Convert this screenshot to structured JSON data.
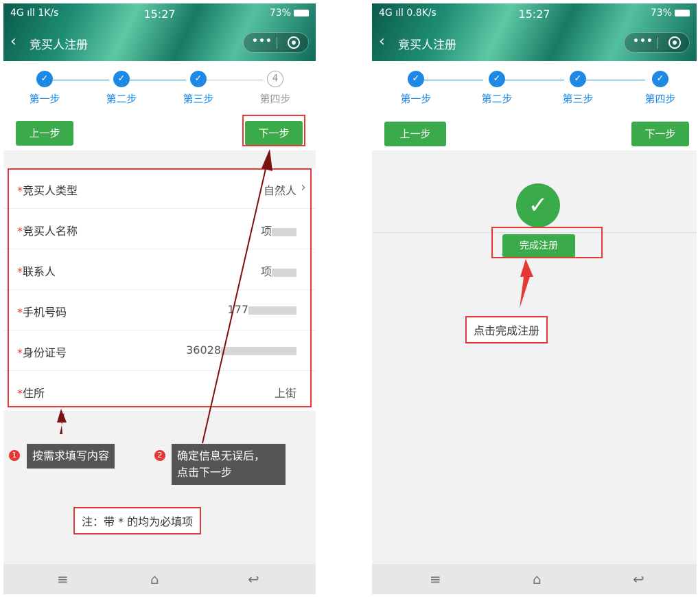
{
  "status_left": {
    "signal": "4G",
    "speed": "1K/s"
  },
  "status_right": {
    "signal": "4G",
    "speed": "0.8K/s"
  },
  "time": "15:27",
  "battery": "73%",
  "app_title": "竞买人注册",
  "steps": [
    "第一步",
    "第二步",
    "第三步",
    "第四步"
  ],
  "step4_number": "4",
  "prev_label": "上一步",
  "next_label": "下一步",
  "form": {
    "fields": [
      {
        "label": "竞买人类型",
        "value": "自然人"
      },
      {
        "label": "竞买人名称",
        "value": "项"
      },
      {
        "label": "联系人",
        "value": "项"
      },
      {
        "label": "手机号码",
        "value": "177"
      },
      {
        "label": "身份证号",
        "value": "36028"
      },
      {
        "label": "住所",
        "value": "上街"
      }
    ],
    "required_mark": "*"
  },
  "annotations": {
    "tip1_num": "1",
    "tip1": "按需求填写内容",
    "tip2_num": "2",
    "tip2_line1": "确定信息无误后，",
    "tip2_line2": "点击下一步",
    "note": "注：带 * 的均为必填项",
    "finish_tip": "点击完成注册"
  },
  "finish_label": "完成注册",
  "colors": {
    "accent_blue": "#1e88e5",
    "button_green": "#3aaa4a",
    "annotation_red": "#e53935"
  }
}
